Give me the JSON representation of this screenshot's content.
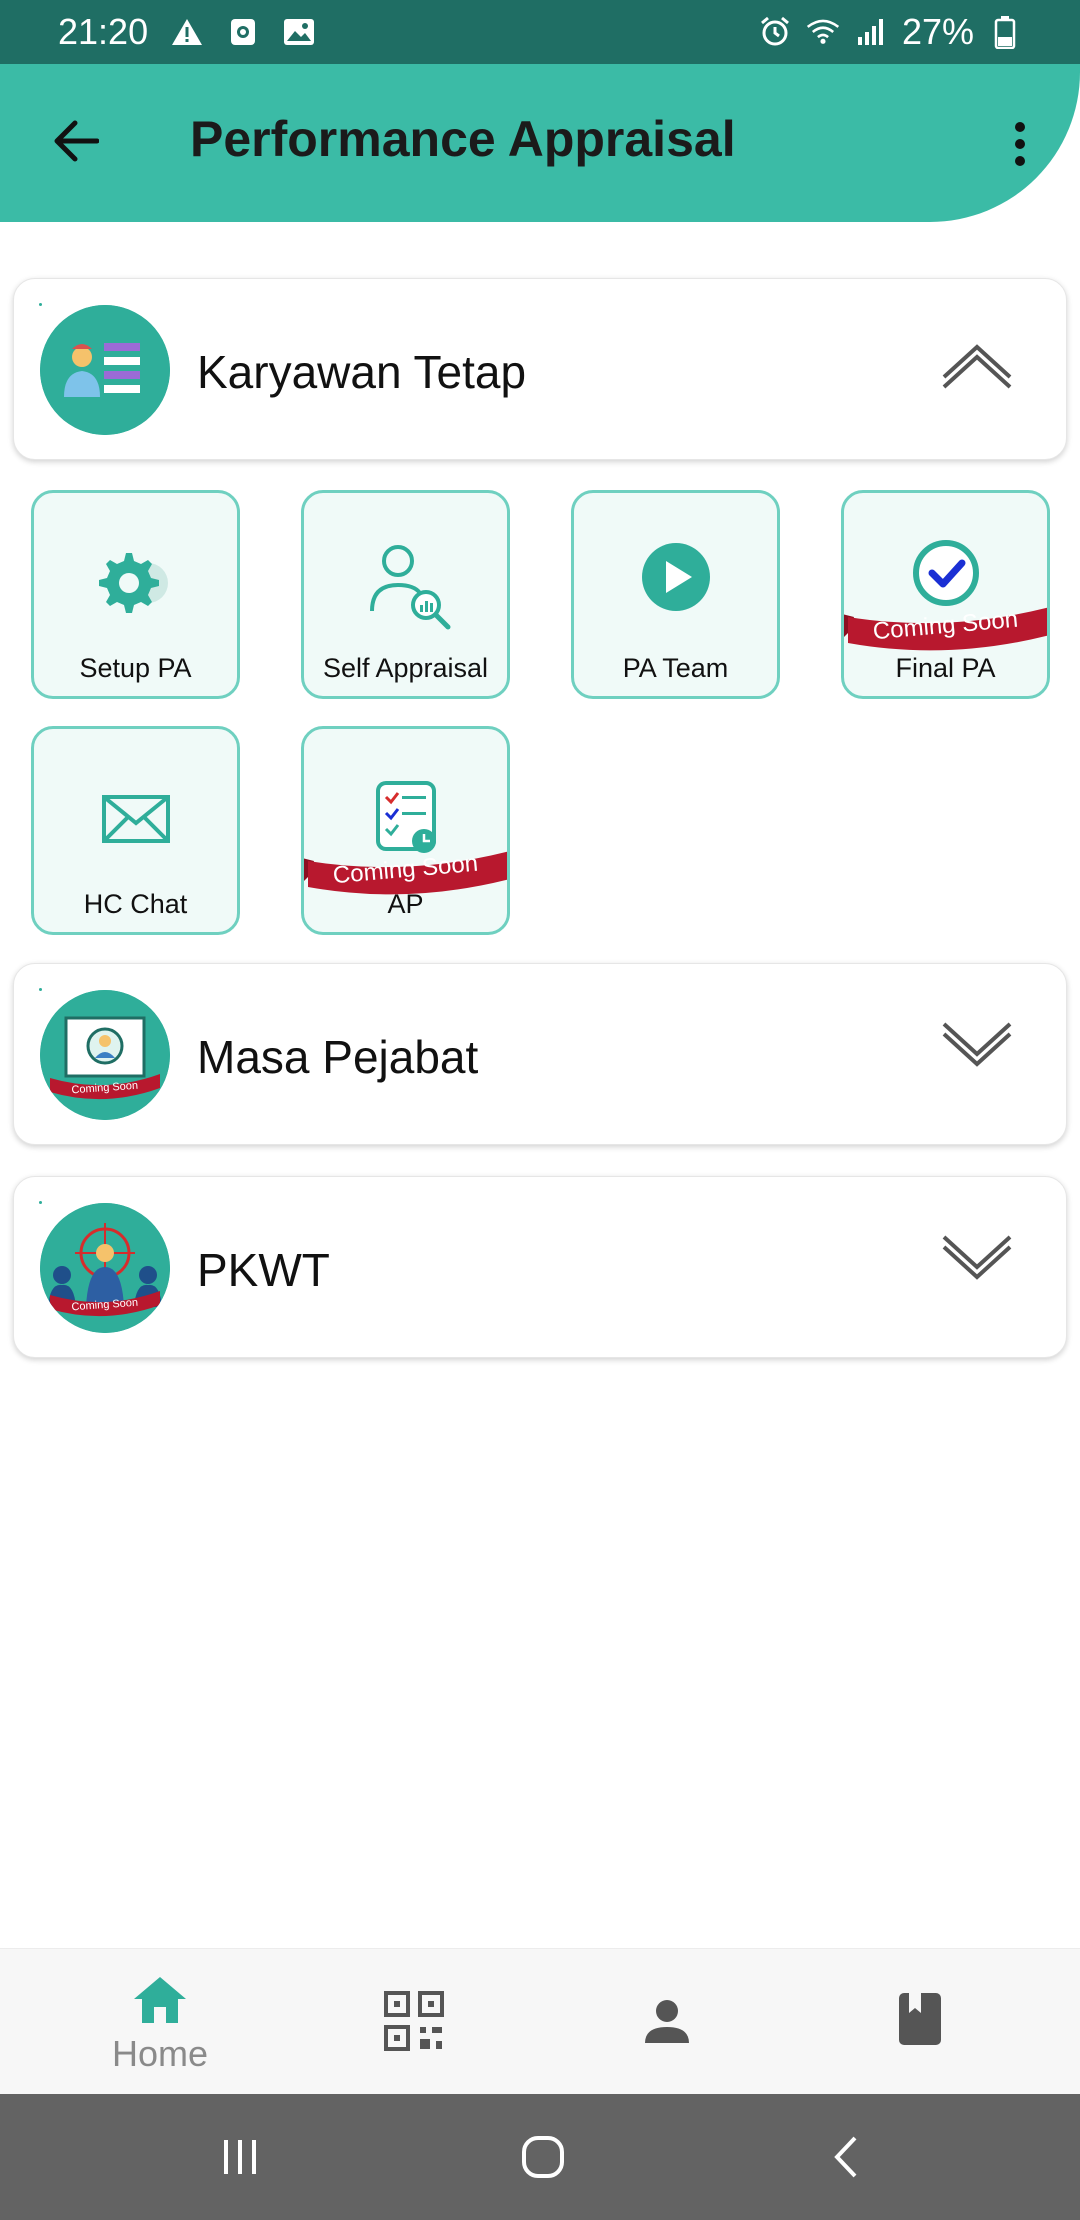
{
  "status_bar": {
    "time": "21:20",
    "battery": "27%",
    "left_icons": [
      "warning-icon",
      "screen-record-icon",
      "image-icon"
    ],
    "right_icons": [
      "alarm-icon",
      "wifi-icon",
      "signal-icon",
      "battery-icon"
    ]
  },
  "app_bar": {
    "title": "Performance Appraisal",
    "color": "#3bbba6"
  },
  "sections": [
    {
      "title": "Karyawan Tetap",
      "expanded": true,
      "icon": "employee-list-icon",
      "tiles": [
        {
          "label": "Setup PA",
          "icon": "gear-icon",
          "coming_soon": false
        },
        {
          "label": "Self Appraisal",
          "icon": "person-search-icon",
          "coming_soon": false
        },
        {
          "label": "PA Team",
          "icon": "play-icon",
          "coming_soon": false
        },
        {
          "label": "Final PA",
          "icon": "check-circle-icon",
          "coming_soon": true
        },
        {
          "label": "HC Chat",
          "icon": "envelope-icon",
          "coming_soon": false
        },
        {
          "label": "AP",
          "icon": "checklist-icon",
          "coming_soon": true
        }
      ]
    },
    {
      "title": "Masa Pejabat",
      "expanded": false,
      "icon": "presentation-icon",
      "coming_soon": true
    },
    {
      "title": "PKWT",
      "expanded": false,
      "icon": "target-person-icon",
      "coming_soon": true
    }
  ],
  "ribbon_text": "Coming Soon",
  "bottom_nav": {
    "items": [
      {
        "label": "Home",
        "icon": "home-icon",
        "active": true
      },
      {
        "label": "",
        "icon": "qr-code-icon",
        "active": false
      },
      {
        "label": "",
        "icon": "person-icon",
        "active": false
      },
      {
        "label": "",
        "icon": "book-icon",
        "active": false
      }
    ]
  },
  "system_nav": {
    "buttons": [
      "recent-apps-icon",
      "home-circle-icon",
      "back-chevron-icon"
    ]
  },
  "colors": {
    "accent": "#3bbba6",
    "accent_dark": "#2fae9a",
    "ribbon": "#b8182e",
    "status_bar": "#1f6e64"
  }
}
